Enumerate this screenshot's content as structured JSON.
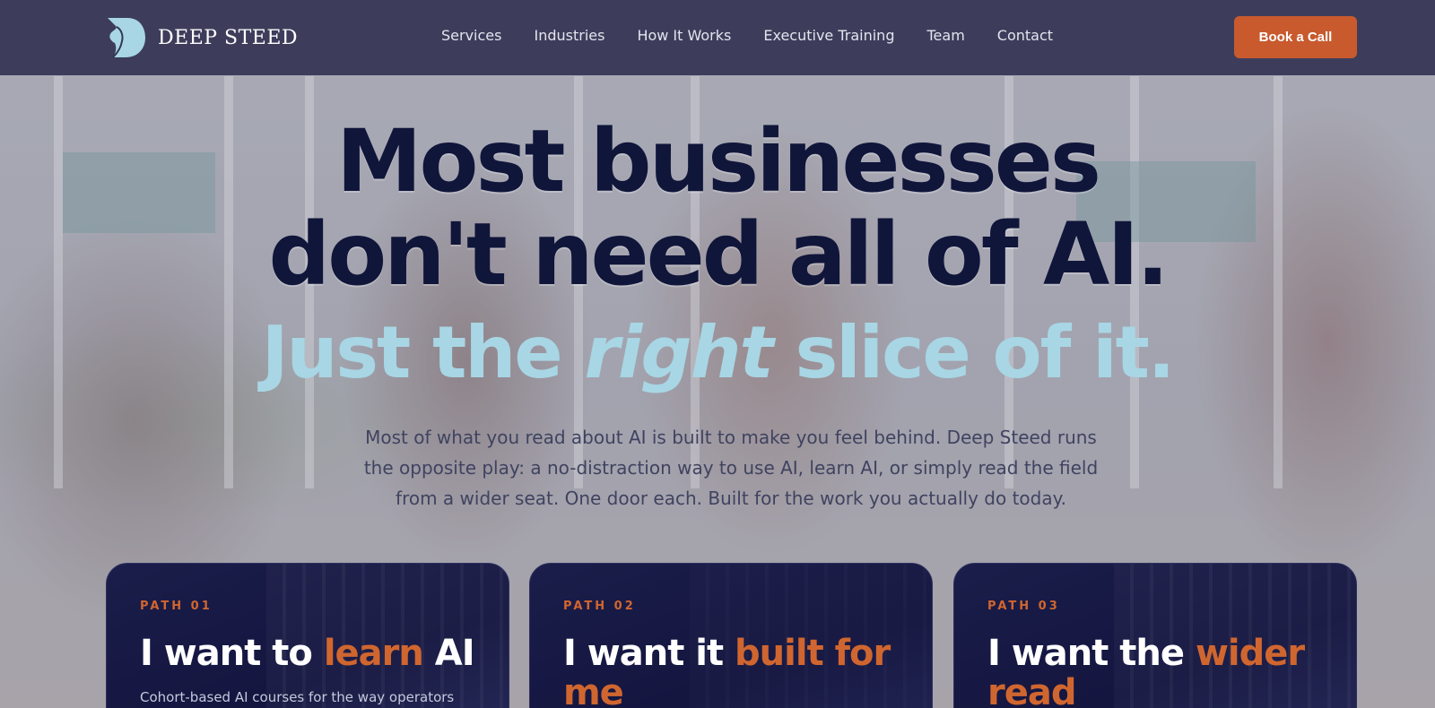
{
  "brand": {
    "name": "DEEP STEED"
  },
  "nav": {
    "items": [
      "Services",
      "Industries",
      "How It Works",
      "Executive Training",
      "Team",
      "Contact"
    ],
    "cta": "Book a Call"
  },
  "hero": {
    "line1": "Most businesses",
    "line2": "don't need all of AI.",
    "tagline_pre": "Just the ",
    "tagline_em": "right",
    "tagline_post": " slice of it.",
    "subtitle": "Most of what you read about AI is built to make you feel behind. Deep Steed runs the opposite play: a no-distraction way to use AI, learn AI, or simply read the field from a wider seat. One door each. Built for the work you actually do today."
  },
  "cards": [
    {
      "kicker": "PATH 01",
      "title_pre": "I want to ",
      "title_accent": "learn",
      "title_post": " AI",
      "desc": "Cohort-based AI courses for the way operators"
    },
    {
      "kicker": "PATH 02",
      "title_pre": "I want it ",
      "title_accent": "built for me",
      "title_post": "",
      "desc": ""
    },
    {
      "kicker": "PATH 03",
      "title_pre": "I want the ",
      "title_accent": "wider read",
      "title_post": "",
      "desc": ""
    }
  ],
  "colors": {
    "header_bg": "#343454",
    "cta_bg": "#c85a2e",
    "headline": "#10153a",
    "tagline": "#a8d6e4",
    "accent": "#d0662f",
    "card_bg": "#161842"
  }
}
